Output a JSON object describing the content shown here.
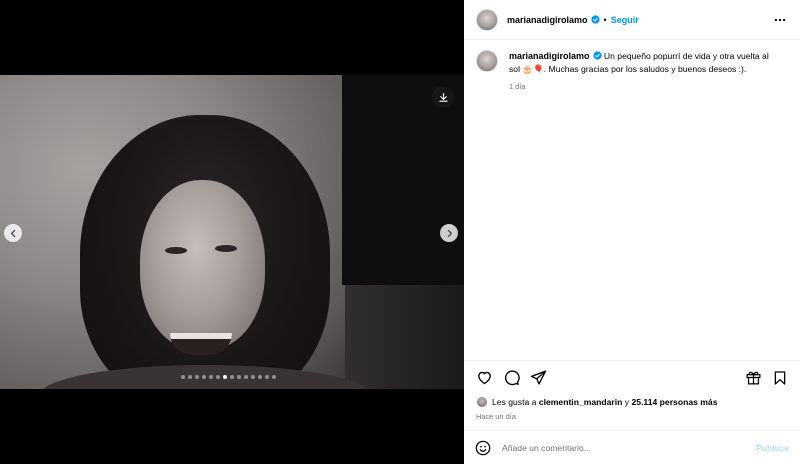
{
  "post": {
    "username": "marianadigirolamo",
    "separator": "•",
    "follow_label": "Seguir",
    "caption": "Un pequeño popurrí de vida y otra vuelta al sol 🎂🎈. Muchas gracias por los saludos y buenos deseos :).",
    "caption_time": "1 día",
    "carousel": {
      "total_slides": 14,
      "active_slide": 6
    }
  },
  "icons": {
    "download": "download-icon",
    "prev": "chevron-left-icon",
    "next": "chevron-right-icon",
    "more": "more-horizontal-icon",
    "verified": "verified-badge-icon",
    "like": "heart-icon",
    "comment": "comment-icon",
    "share": "share-icon",
    "save": "bookmark-icon",
    "gift": "gift-icon",
    "emoji": "emoji-icon"
  },
  "likes": {
    "prefix": "Les gusta a",
    "user": "clementin_mandarin",
    "connector": "y",
    "count_text": "25.114 personas más"
  },
  "posted_ago": "Hace un día",
  "comment": {
    "placeholder": "Añade un comentario...",
    "publish_label": "Publicar"
  },
  "colors": {
    "accent": "#0095f6",
    "publish_disabled": "#b2dffc",
    "muted_text": "#737373",
    "media_bg": "#000000"
  }
}
